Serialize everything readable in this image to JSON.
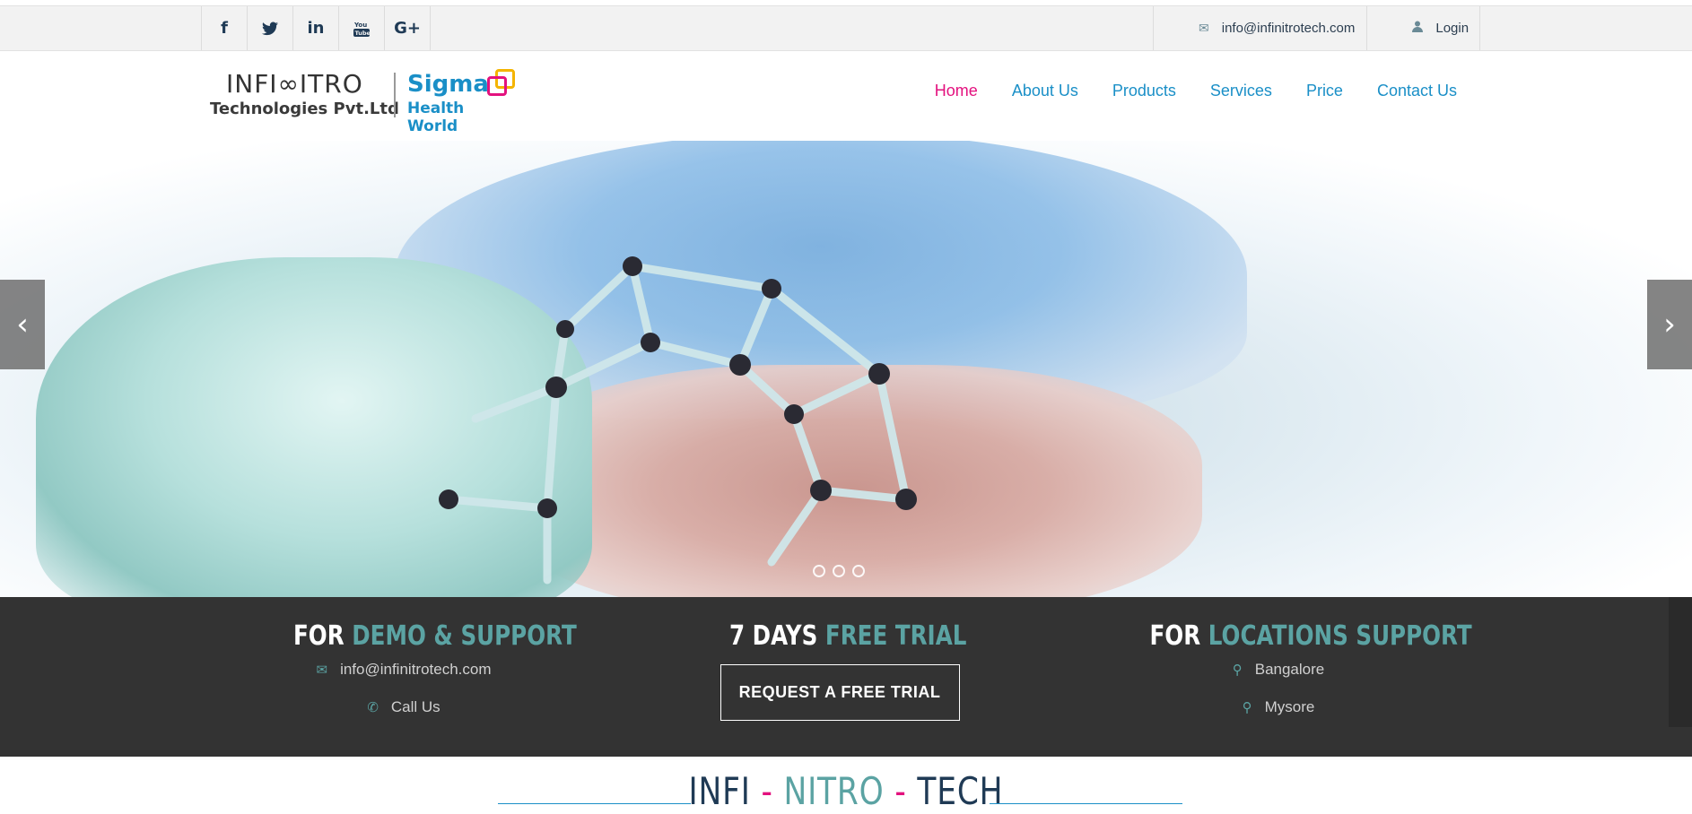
{
  "topbar": {
    "socials": [
      {
        "icon": "facebook-icon",
        "glyph": "f"
      },
      {
        "icon": "twitter-icon",
        "glyph": "🐦"
      },
      {
        "icon": "linkedin-icon",
        "glyph": "in"
      },
      {
        "icon": "youtube-icon",
        "glyph": "You\nTube"
      },
      {
        "icon": "google-plus-icon",
        "glyph": "G+"
      }
    ],
    "email": "info@infinitrotech.com",
    "login": "Login"
  },
  "logo": {
    "line1": "INFI∞ITRO",
    "line2": "Technologies Pvt.Ltd",
    "brand1": "Sigma",
    "brand2": "Health World"
  },
  "nav": {
    "items": [
      "Home",
      "About Us",
      "Products",
      "Services",
      "Price",
      "Contact Us"
    ],
    "active": "Home"
  },
  "hero": {
    "slides": 3,
    "active_slide": 0
  },
  "strip": {
    "demo": {
      "title_white": "FOR",
      "title_accent": "DEMO & SUPPORT",
      "email": "info@infinitrotech.com",
      "call": "Call Us"
    },
    "trial": {
      "title_white": "7 DAYS",
      "title_accent": "FREE TRIAL",
      "button": "REQUEST A FREE TRIAL"
    },
    "locations": {
      "title_white": "FOR",
      "title_accent": "LOCATIONS SUPPORT",
      "city1": "Bangalore",
      "city2": "Mysore"
    }
  },
  "section": {
    "part1": "INFI",
    "sep": "-",
    "part2": "NITRO",
    "part3": "TECH"
  },
  "colors": {
    "brand_blue": "#1a8fc7",
    "active_pink": "#e3117e",
    "teal_accent": "#5ba3a3",
    "dark_strip": "#333333"
  }
}
